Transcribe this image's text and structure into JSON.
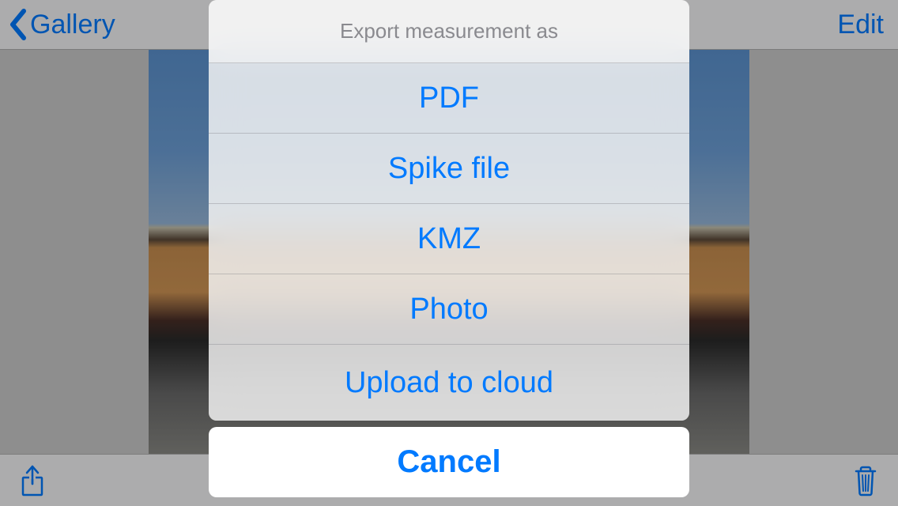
{
  "nav": {
    "back_label": "Gallery",
    "edit_label": "Edit"
  },
  "action_sheet": {
    "title": "Export measurement as",
    "options": {
      "opt0": "PDF",
      "opt1": "Spike file",
      "opt2": "KMZ",
      "opt3": "Photo",
      "opt4": "Upload to cloud"
    },
    "cancel": "Cancel"
  }
}
